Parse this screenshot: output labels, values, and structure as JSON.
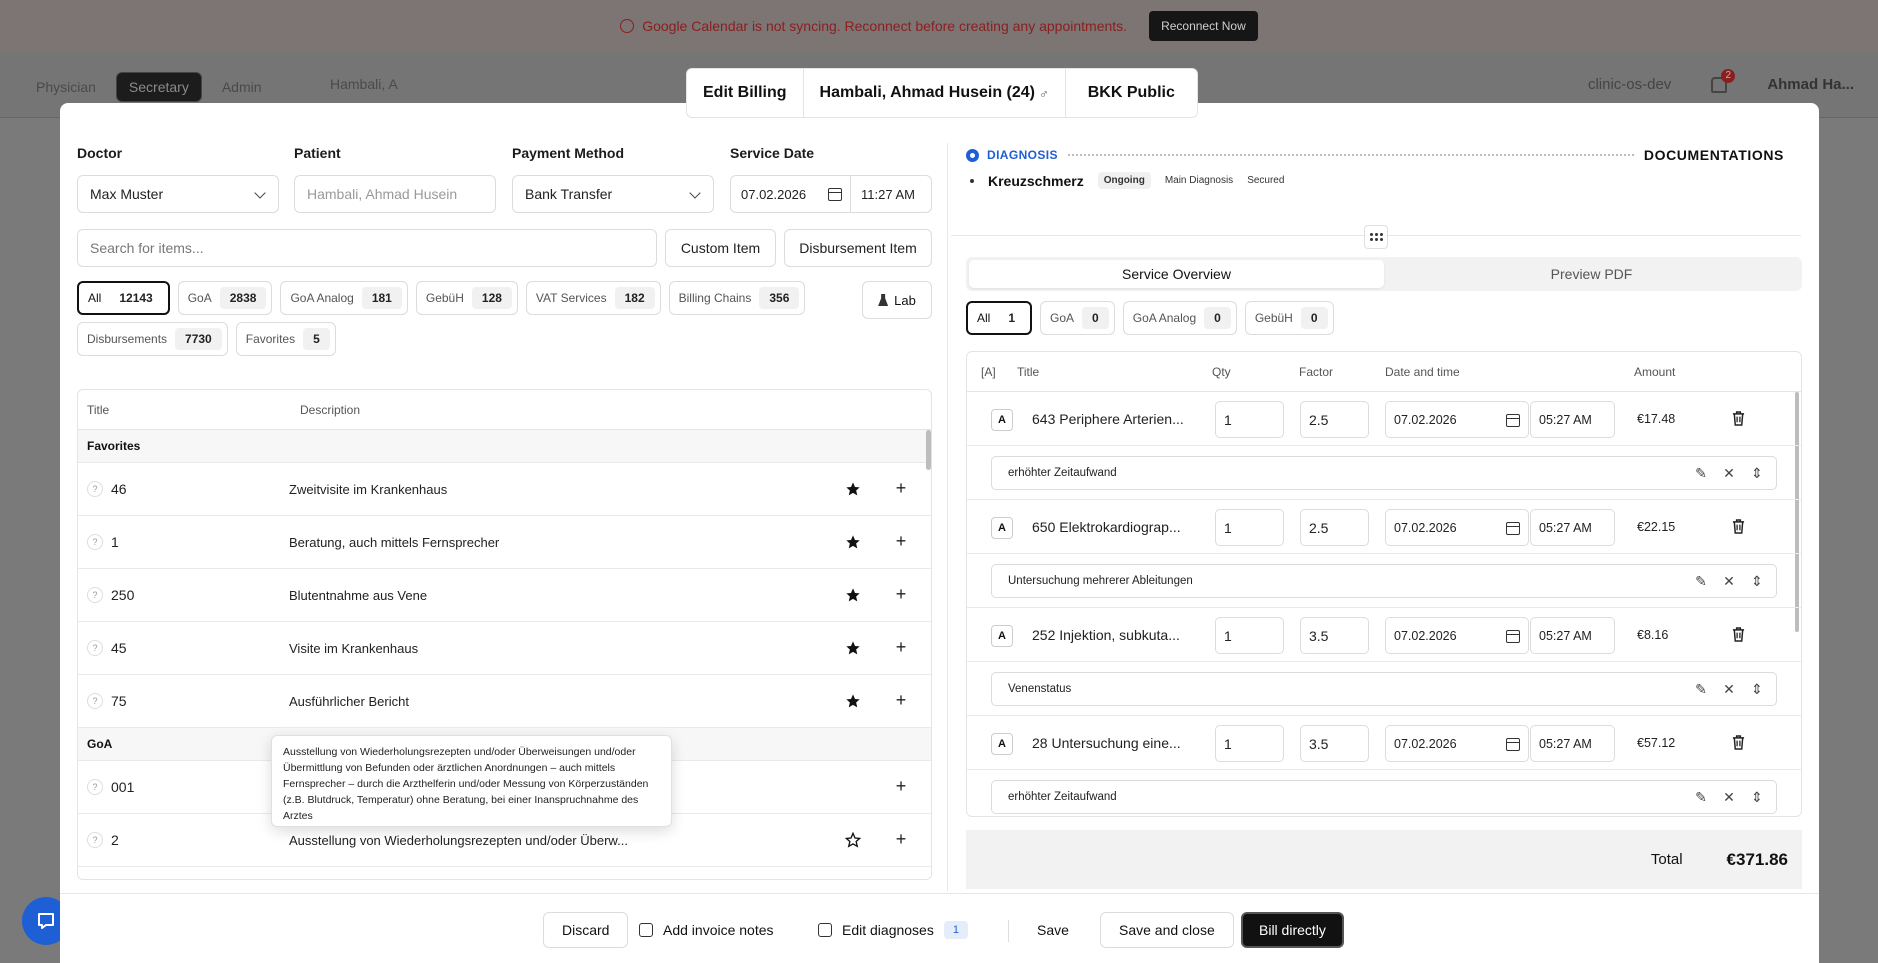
{
  "background": {
    "banner_text": "Google Calendar is not syncing. Reconnect before creating any appointments.",
    "banner_button": "Reconnect Now",
    "nav_tabs": [
      "Physician",
      "Secretary",
      "Admin"
    ],
    "patient_chip": "Hambali, A",
    "org": "clinic-os-dev",
    "notifications": "2",
    "user": "Ahmad Ha..."
  },
  "modal_tabs": {
    "edit": "Edit Billing",
    "patient": "Hambali, Ahmad Husein (24)",
    "sex": "♂",
    "insurance": "BKK Public"
  },
  "form": {
    "doctor_label": "Doctor",
    "doctor_value": "Max Muster",
    "patient_label": "Patient",
    "patient_placeholder": "Hambali, Ahmad Husein",
    "payment_label": "Payment Method",
    "payment_value": "Bank Transfer",
    "date_label": "Service Date",
    "date_value": "07.02.2026",
    "time_value": "11:27 AM"
  },
  "search": {
    "placeholder": "Search for items...",
    "custom_item": "Custom Item",
    "disbursement_item": "Disbursement Item"
  },
  "filters": [
    {
      "label": "All",
      "count": "12143",
      "active": true
    },
    {
      "label": "GoA",
      "count": "2838"
    },
    {
      "label": "GoA Analog",
      "count": "181"
    },
    {
      "label": "GebüH",
      "count": "128"
    },
    {
      "label": "VAT Services",
      "count": "182"
    },
    {
      "label": "Billing Chains",
      "count": "356"
    },
    {
      "label": "Disbursements",
      "count": "7730"
    },
    {
      "label": "Favorites",
      "count": "5"
    }
  ],
  "lab_button": "Lab",
  "catalog": {
    "col_title": "Title",
    "col_description": "Description",
    "group_favorites": "Favorites",
    "favorites": [
      {
        "code": "46",
        "desc": "Zweitvisite im Krankenhaus"
      },
      {
        "code": "1",
        "desc": "Beratung, auch mittels Fernsprecher"
      },
      {
        "code": "250",
        "desc": "Blutentnahme aus Vene"
      },
      {
        "code": "45",
        "desc": "Visite im Krankenhaus"
      },
      {
        "code": "75",
        "desc": "Ausführlicher Bericht"
      }
    ],
    "group_goa": "GoA",
    "goa": [
      {
        "code": "001",
        "desc": ""
      },
      {
        "code": "2",
        "desc": "Ausstellung von Wiederholungsrezepten und/oder Überw..."
      }
    ],
    "tooltip": "Ausstellung von Wiederholungsrezepten und/oder Überweisungen und/oder Übermittlung von Befunden oder ärztlichen Anordnungen – auch mittels Fernsprecher – durch die Arzthelferin und/oder Messung von Körperzuständen (z.B. Blutdruck, Temperatur) ohne Beratung, bei einer Inanspruchnahme des Arztes"
  },
  "diagnosis": {
    "label": "DIAGNOSIS",
    "documentations": "DOCUMENTATIONS",
    "name": "Kreuzschmerz",
    "status": "Ongoing",
    "type": "Main Diagnosis",
    "certainty": "Secured"
  },
  "view_tabs": {
    "service_overview": "Service Overview",
    "preview_pdf": "Preview PDF"
  },
  "right_filters": [
    {
      "label": "All",
      "count": "1",
      "active": true
    },
    {
      "label": "GoA",
      "count": "0"
    },
    {
      "label": "GoA Analog",
      "count": "0"
    },
    {
      "label": "GebüH",
      "count": "0"
    }
  ],
  "services_table": {
    "col_a": "[A]",
    "col_title": "Title",
    "col_qty": "Qty",
    "col_factor": "Factor",
    "col_datetime": "Date and time",
    "col_amount": "Amount",
    "rows": [
      {
        "a": "A",
        "title": "643 Periphere Arterien...",
        "qty": "1",
        "factor": "2.5",
        "date": "07.02.2026",
        "time": "05:27 AM",
        "amount": "€17.48",
        "note": "erhöhter Zeitaufwand"
      },
      {
        "a": "A",
        "title": "650 Elektrokardiograp...",
        "qty": "1",
        "factor": "2.5",
        "date": "07.02.2026",
        "time": "05:27 AM",
        "amount": "€22.15",
        "note": "Untersuchung mehrerer Ableitungen"
      },
      {
        "a": "A",
        "title": "252 Injektion, subkuta...",
        "qty": "1",
        "factor": "3.5",
        "date": "07.02.2026",
        "time": "05:27 AM",
        "amount": "€8.16",
        "note": "Venenstatus"
      },
      {
        "a": "A",
        "title": "28 Untersuchung eine...",
        "qty": "1",
        "factor": "3.5",
        "date": "07.02.2026",
        "time": "05:27 AM",
        "amount": "€57.12",
        "note": "erhöhter Zeitaufwand"
      }
    ]
  },
  "total": {
    "label": "Total",
    "value": "€371.86"
  },
  "footer": {
    "discard": "Discard",
    "add_notes": "Add invoice notes",
    "edit_diagnoses": "Edit diagnoses",
    "diagnoses_count": "1",
    "save": "Save",
    "save_close": "Save and close",
    "bill_directly": "Bill directly"
  }
}
